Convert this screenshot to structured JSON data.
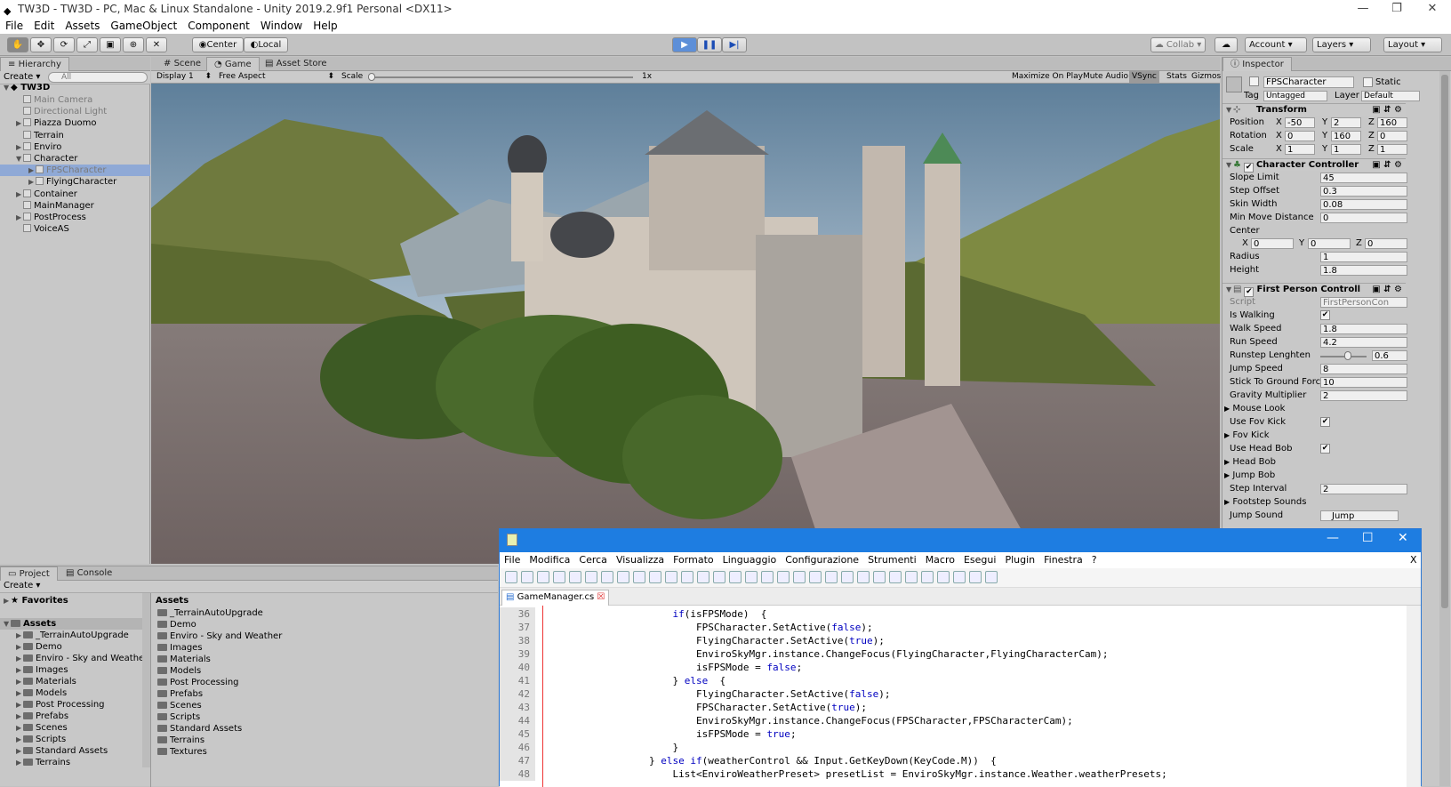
{
  "window": {
    "title": "TW3D - TW3D - PC, Mac & Linux Standalone - Unity 2019.2.9f1 Personal <DX11>",
    "minimize": "—",
    "maximize": "❐",
    "close": "✕"
  },
  "menu": [
    "File",
    "Edit",
    "Assets",
    "GameObject",
    "Component",
    "Window",
    "Help"
  ],
  "toolbar": {
    "pivot": "Center",
    "space": "Local",
    "collab": "Collab",
    "account": "Account",
    "layers": "Layers",
    "layout": "Layout"
  },
  "hierarchy": {
    "tab": "Hierarchy",
    "create": "Create",
    "search_placeholder": "All",
    "scene": "TW3D",
    "items": [
      {
        "label": "Main Camera",
        "indent": 1,
        "gray": true
      },
      {
        "label": "Directional Light",
        "indent": 1,
        "gray": true
      },
      {
        "label": "Piazza Duomo",
        "indent": 1,
        "arrow": true
      },
      {
        "label": "Terrain",
        "indent": 1
      },
      {
        "label": "Enviro",
        "indent": 1,
        "arrow": true
      },
      {
        "label": "Character",
        "indent": 1,
        "arrow": true,
        "open": true
      },
      {
        "label": "FPSCharacter",
        "indent": 2,
        "arrow": true,
        "gray": true,
        "selected": true
      },
      {
        "label": "FlyingCharacter",
        "indent": 2,
        "arrow": true
      },
      {
        "label": "Container",
        "indent": 1,
        "arrow": true
      },
      {
        "label": "MainManager",
        "indent": 1
      },
      {
        "label": "PostProcess",
        "indent": 1,
        "arrow": true
      },
      {
        "label": "VoiceAS",
        "indent": 1
      }
    ]
  },
  "game": {
    "tabs": [
      "Scene",
      "Game",
      "Asset Store"
    ],
    "display": "Display 1",
    "aspect": "Free Aspect",
    "scale_label": "Scale",
    "scale_value": "1x",
    "options": [
      "Maximize On Play",
      "Mute Audio",
      "VSync",
      "Stats",
      "Gizmos"
    ]
  },
  "project": {
    "tabs": [
      "Project",
      "Console"
    ],
    "create": "Create",
    "favorites": "Favorites",
    "assets_root": "Assets",
    "tree": [
      "_TerrainAutoUpgrade",
      "Demo",
      "Enviro - Sky and Weathe",
      "Images",
      "Materials",
      "Models",
      "Post Processing",
      "Prefabs",
      "Scenes",
      "Scripts",
      "Standard Assets",
      "Terrains"
    ],
    "assets_header": "Assets",
    "list": [
      "_TerrainAutoUpgrade",
      "Demo",
      "Enviro - Sky and Weather",
      "Images",
      "Materials",
      "Models",
      "Post Processing",
      "Prefabs",
      "Scenes",
      "Scripts",
      "Standard Assets",
      "Terrains",
      "Textures"
    ]
  },
  "inspector": {
    "tab": "Inspector",
    "object_name": "FPSCharacter",
    "static": "Static",
    "tag_label": "Tag",
    "tag": "Untagged",
    "layer_label": "Layer",
    "layer": "Default",
    "transform": {
      "title": "Transform",
      "position": {
        "label": "Position",
        "x": "-50",
        "y": "2",
        "z": "160"
      },
      "rotation": {
        "label": "Rotation",
        "x": "0",
        "y": "160",
        "z": "0"
      },
      "scale": {
        "label": "Scale",
        "x": "1",
        "y": "1",
        "z": "1"
      }
    },
    "cc": {
      "title": "Character Controller",
      "slope_limit": {
        "label": "Slope Limit",
        "value": "45"
      },
      "step_offset": {
        "label": "Step Offset",
        "value": "0.3"
      },
      "skin_width": {
        "label": "Skin Width",
        "value": "0.08"
      },
      "min_move": {
        "label": "Min Move Distance",
        "value": "0"
      },
      "center": {
        "label": "Center",
        "x": "0",
        "y": "0",
        "z": "0"
      },
      "radius": {
        "label": "Radius",
        "value": "1"
      },
      "height": {
        "label": "Height",
        "value": "1.8"
      }
    },
    "fpc": {
      "title": "First Person Controll",
      "script_label": "Script",
      "script": "FirstPersonCon",
      "is_walking": "Is Walking",
      "walk_speed": {
        "label": "Walk Speed",
        "value": "1.8"
      },
      "run_speed": {
        "label": "Run Speed",
        "value": "4.2"
      },
      "runstep": {
        "label": "Runstep Lenghten",
        "value": "0.6",
        "fraction": 0.6
      },
      "jump_speed": {
        "label": "Jump Speed",
        "value": "8"
      },
      "stick": {
        "label": "Stick To Ground Forc",
        "value": "10"
      },
      "gravity": {
        "label": "Gravity Multiplier",
        "value": "2"
      },
      "mouse_look": "Mouse Look",
      "use_fov_kick": "Use Fov Kick",
      "fov_kick": "Fov Kick",
      "use_head_bob": "Use Head Bob",
      "head_bob": "Head Bob",
      "jump_bob": "Jump Bob",
      "step_interval": {
        "label": "Step Interval",
        "value": "2"
      },
      "footstep": "Footstep Sounds",
      "jump_sound": {
        "label": "Jump Sound",
        "value": "Jump"
      }
    }
  },
  "notepad": {
    "menu": [
      "File",
      "Modifica",
      "Cerca",
      "Visualizza",
      "Formato",
      "Linguaggio",
      "Configurazione",
      "Strumenti",
      "Macro",
      "Esegui",
      "Plugin",
      "Finestra",
      "?"
    ],
    "close_doc": "X",
    "tab": "GameManager.cs",
    "lines": [
      {
        "n": "36",
        "indent": 10,
        "parts": [
          [
            "kw",
            "if"
          ],
          [
            "",
            "(isFPSMode)  {"
          ]
        ]
      },
      {
        "n": "37",
        "indent": 12,
        "parts": [
          [
            "",
            "FPSCharacter.SetActive("
          ],
          [
            "kw",
            "false"
          ],
          [
            "",
            ");"
          ]
        ]
      },
      {
        "n": "38",
        "indent": 12,
        "parts": [
          [
            "",
            "FlyingCharacter.SetActive("
          ],
          [
            "kw",
            "true"
          ],
          [
            "",
            ");"
          ]
        ]
      },
      {
        "n": "39",
        "indent": 12,
        "parts": [
          [
            "",
            "EnviroSkyMgr.instance.ChangeFocus(FlyingCharacter,FlyingCharacterCam);"
          ]
        ]
      },
      {
        "n": "40",
        "indent": 12,
        "parts": [
          [
            "",
            "isFPSMode = "
          ],
          [
            "kw",
            "false"
          ],
          [
            "",
            ";"
          ]
        ]
      },
      {
        "n": "41",
        "indent": 10,
        "parts": [
          [
            "",
            "} "
          ],
          [
            "kw",
            "else"
          ],
          [
            "",
            "  {"
          ]
        ]
      },
      {
        "n": "42",
        "indent": 12,
        "parts": [
          [
            "",
            "FlyingCharacter.SetActive("
          ],
          [
            "kw",
            "false"
          ],
          [
            "",
            ");"
          ]
        ]
      },
      {
        "n": "43",
        "indent": 12,
        "parts": [
          [
            "",
            "FPSCharacter.SetActive("
          ],
          [
            "kw",
            "true"
          ],
          [
            "",
            ");"
          ]
        ]
      },
      {
        "n": "44",
        "indent": 12,
        "parts": [
          [
            "",
            "EnviroSkyMgr.instance.ChangeFocus(FPSCharacter,FPSCharacterCam);"
          ]
        ]
      },
      {
        "n": "45",
        "indent": 12,
        "parts": [
          [
            "",
            "isFPSMode = "
          ],
          [
            "kw",
            "true"
          ],
          [
            "",
            ";"
          ]
        ]
      },
      {
        "n": "46",
        "indent": 10,
        "parts": [
          [
            "",
            "}"
          ]
        ]
      },
      {
        "n": "47",
        "indent": 8,
        "parts": [
          [
            "",
            "} "
          ],
          [
            "kw",
            "else if"
          ],
          [
            "",
            "(weatherControl && Input.GetKeyDown(KeyCode.M))  {"
          ]
        ]
      },
      {
        "n": "48",
        "indent": 10,
        "parts": [
          [
            "",
            "List<EnviroWeatherPreset> presetList = EnviroSkyMgr.instance.Weather.weatherPresets;"
          ]
        ]
      }
    ]
  }
}
